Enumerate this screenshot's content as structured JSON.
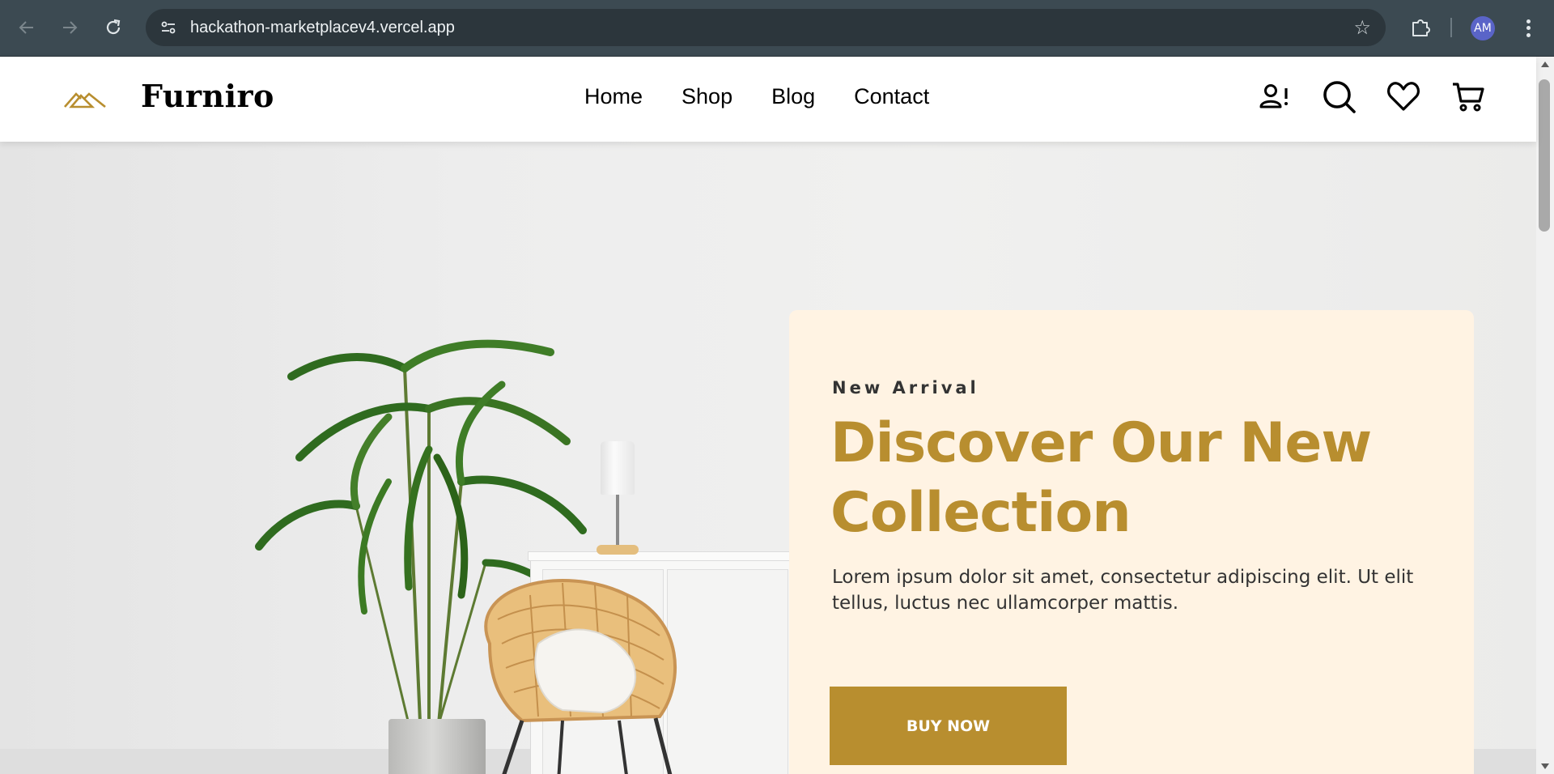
{
  "browser": {
    "url": "hackathon-marketplacev4.vercel.app",
    "avatar_initials": "AM"
  },
  "site": {
    "brand": "Furniro",
    "brand_color": "#b88e2f",
    "nav": [
      {
        "label": "Home"
      },
      {
        "label": "Shop"
      },
      {
        "label": "Blog"
      },
      {
        "label": "Contact"
      }
    ],
    "header_icons": [
      "account-alert-icon",
      "search-icon",
      "heart-icon",
      "cart-icon"
    ]
  },
  "hero": {
    "eyebrow": "New Arrival",
    "title": "Discover Our New Collection",
    "description": "Lorem ipsum dolor sit amet, consectetur adipiscing elit. Ut elit tellus, luctus nec ullamcorper mattis.",
    "cta_label": "BUY NOW",
    "card_color": "#fff3e3"
  }
}
